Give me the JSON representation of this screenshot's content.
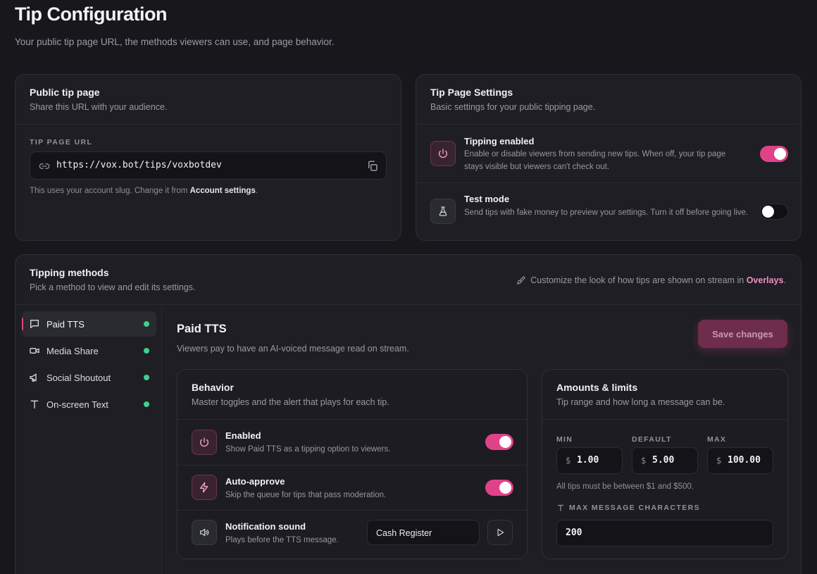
{
  "page": {
    "title": "Tip Configuration",
    "subtitle": "Your public tip page URL, the methods viewers can use, and page behavior."
  },
  "public_page": {
    "title": "Public tip page",
    "description": "Share this URL with your audience.",
    "url_label": "TIP PAGE URL",
    "url": "https://vox.bot/tips/voxbotdev",
    "helper_prefix": "This uses your account slug. Change it from ",
    "helper_link": "Account settings",
    "helper_suffix": "."
  },
  "settings": {
    "title": "Tip Page Settings",
    "description": "Basic settings for your public tipping page.",
    "tipping_enabled": {
      "title": "Tipping enabled",
      "description": "Enable or disable viewers from sending new tips. When off, your tip page stays visible but viewers can't check out.",
      "on": true
    },
    "test_mode": {
      "title": "Test mode",
      "description": "Send tips with fake money to preview your settings. Turn it off before going live.",
      "on": false
    }
  },
  "methods": {
    "title": "Tipping methods",
    "description": "Pick a method to view and edit its settings.",
    "note_prefix": "Customize the look of how tips are shown on stream in ",
    "note_link": "Overlays",
    "note_suffix": ".",
    "items": [
      {
        "label": "Paid TTS",
        "icon": "message-icon",
        "active": true
      },
      {
        "label": "Media Share",
        "icon": "video-icon",
        "active": false
      },
      {
        "label": "Social Shoutout",
        "icon": "megaphone-icon",
        "active": false
      },
      {
        "label": "On-screen Text",
        "icon": "text-icon",
        "active": false
      }
    ]
  },
  "panel": {
    "title": "Paid TTS",
    "description": "Viewers pay to have an AI-voiced message read on stream.",
    "save_label": "Save changes",
    "behavior": {
      "title": "Behavior",
      "description": "Master toggles and the alert that plays for each tip.",
      "enabled": {
        "title": "Enabled",
        "description": "Show Paid TTS as a tipping option to viewers.",
        "on": true
      },
      "auto_approve": {
        "title": "Auto-approve",
        "description": "Skip the queue for tips that pass moderation.",
        "on": true
      },
      "sound": {
        "title": "Notification sound",
        "description": "Plays before the TTS message.",
        "selected": "Cash Register"
      }
    },
    "amounts": {
      "title": "Amounts & limits",
      "description": "Tip range and how long a message can be.",
      "min_label": "MIN",
      "default_label": "DEFAULT",
      "max_label": "MAX",
      "currency": "$",
      "min": "1.00",
      "default": "5.00",
      "max": "100.00",
      "range_note": "All tips must be between $1 and $500.",
      "max_chars_label": "MAX MESSAGE CHARACTERS",
      "max_chars": "200"
    }
  },
  "colors": {
    "accent": "#e0428a",
    "status_dot": "#3fcf8e",
    "background": "#17171c"
  }
}
